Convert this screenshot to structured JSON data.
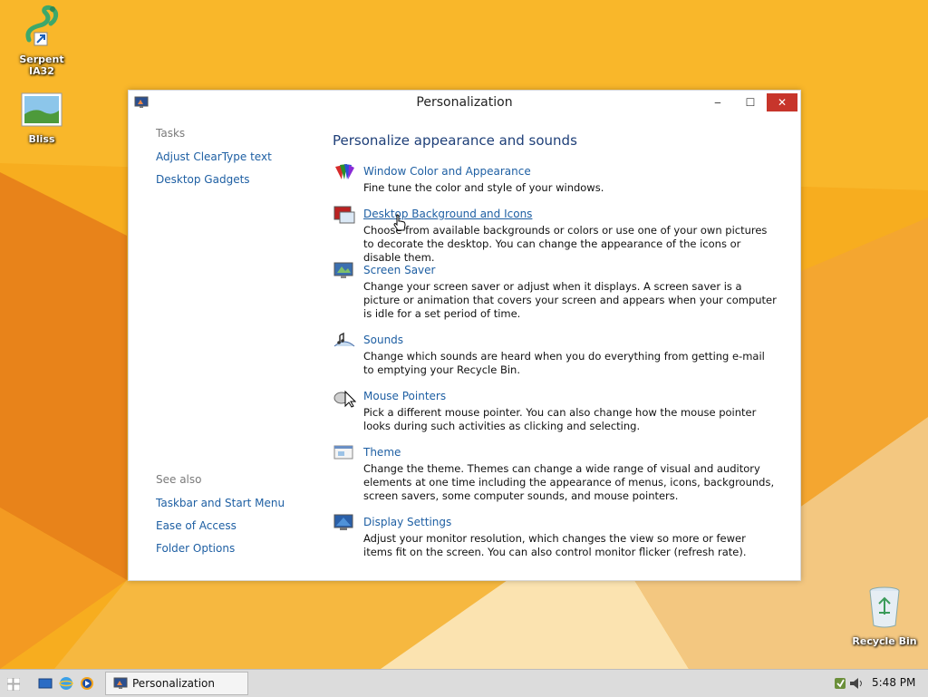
{
  "desktop": {
    "icons": [
      {
        "label": "Serpent IA32",
        "icon": "snake-icon"
      },
      {
        "label": "Bliss",
        "icon": "picture-icon"
      },
      {
        "label": "Recycle Bin",
        "icon": "recycle-bin-icon"
      }
    ]
  },
  "window": {
    "title": "Personalization",
    "controls": {
      "minimize": "‒",
      "maximize": "☐",
      "close": "✕"
    },
    "sidebar": {
      "tasks_heading": "Tasks",
      "tasks": [
        "Adjust ClearType text",
        "Desktop Gadgets"
      ],
      "see_also_heading": "See also",
      "see_also": [
        "Taskbar and Start Menu",
        "Ease of Access",
        "Folder Options"
      ]
    },
    "main": {
      "heading": "Personalize appearance and sounds",
      "items": [
        {
          "icon": "color-palette-icon",
          "title": "Window Color and Appearance",
          "description": "Fine tune the color and style of your windows."
        },
        {
          "icon": "desktop-background-icon",
          "title": "Desktop Background and Icons",
          "description": "Choose from available backgrounds or colors or use one of your own pictures to decorate the desktop. You can change the appearance of the icons or disable them."
        },
        {
          "icon": "screen-saver-icon",
          "title": "Screen Saver",
          "description": "Change your screen saver or adjust when it displays. A screen saver is a picture or animation that covers your screen and appears when your computer is idle for a set period of time."
        },
        {
          "icon": "sounds-icon",
          "title": "Sounds",
          "description": "Change which sounds are heard when you do everything from getting e-mail to emptying your Recycle Bin."
        },
        {
          "icon": "mouse-pointer-icon",
          "title": "Mouse Pointers",
          "description": "Pick a different mouse pointer. You can also change how the mouse pointer looks during such activities as clicking and selecting."
        },
        {
          "icon": "theme-icon",
          "title": "Theme",
          "description": "Change the theme. Themes can change a wide range of visual and auditory elements at one time including the appearance of menus, icons, backgrounds, screen savers, some computer sounds, and mouse pointers."
        },
        {
          "icon": "display-settings-icon",
          "title": "Display Settings",
          "description": "Adjust your monitor resolution, which changes the view so more or fewer items fit on the screen. You can also control monitor flicker (refresh rate)."
        }
      ]
    }
  },
  "taskbar": {
    "task_label": "Personalization",
    "clock": "5:48 PM"
  },
  "colors": {
    "wallpaper": "#f6a81a",
    "link": "#1e5fa3",
    "heading": "#1e3f78",
    "close_button": "#c7352b"
  }
}
